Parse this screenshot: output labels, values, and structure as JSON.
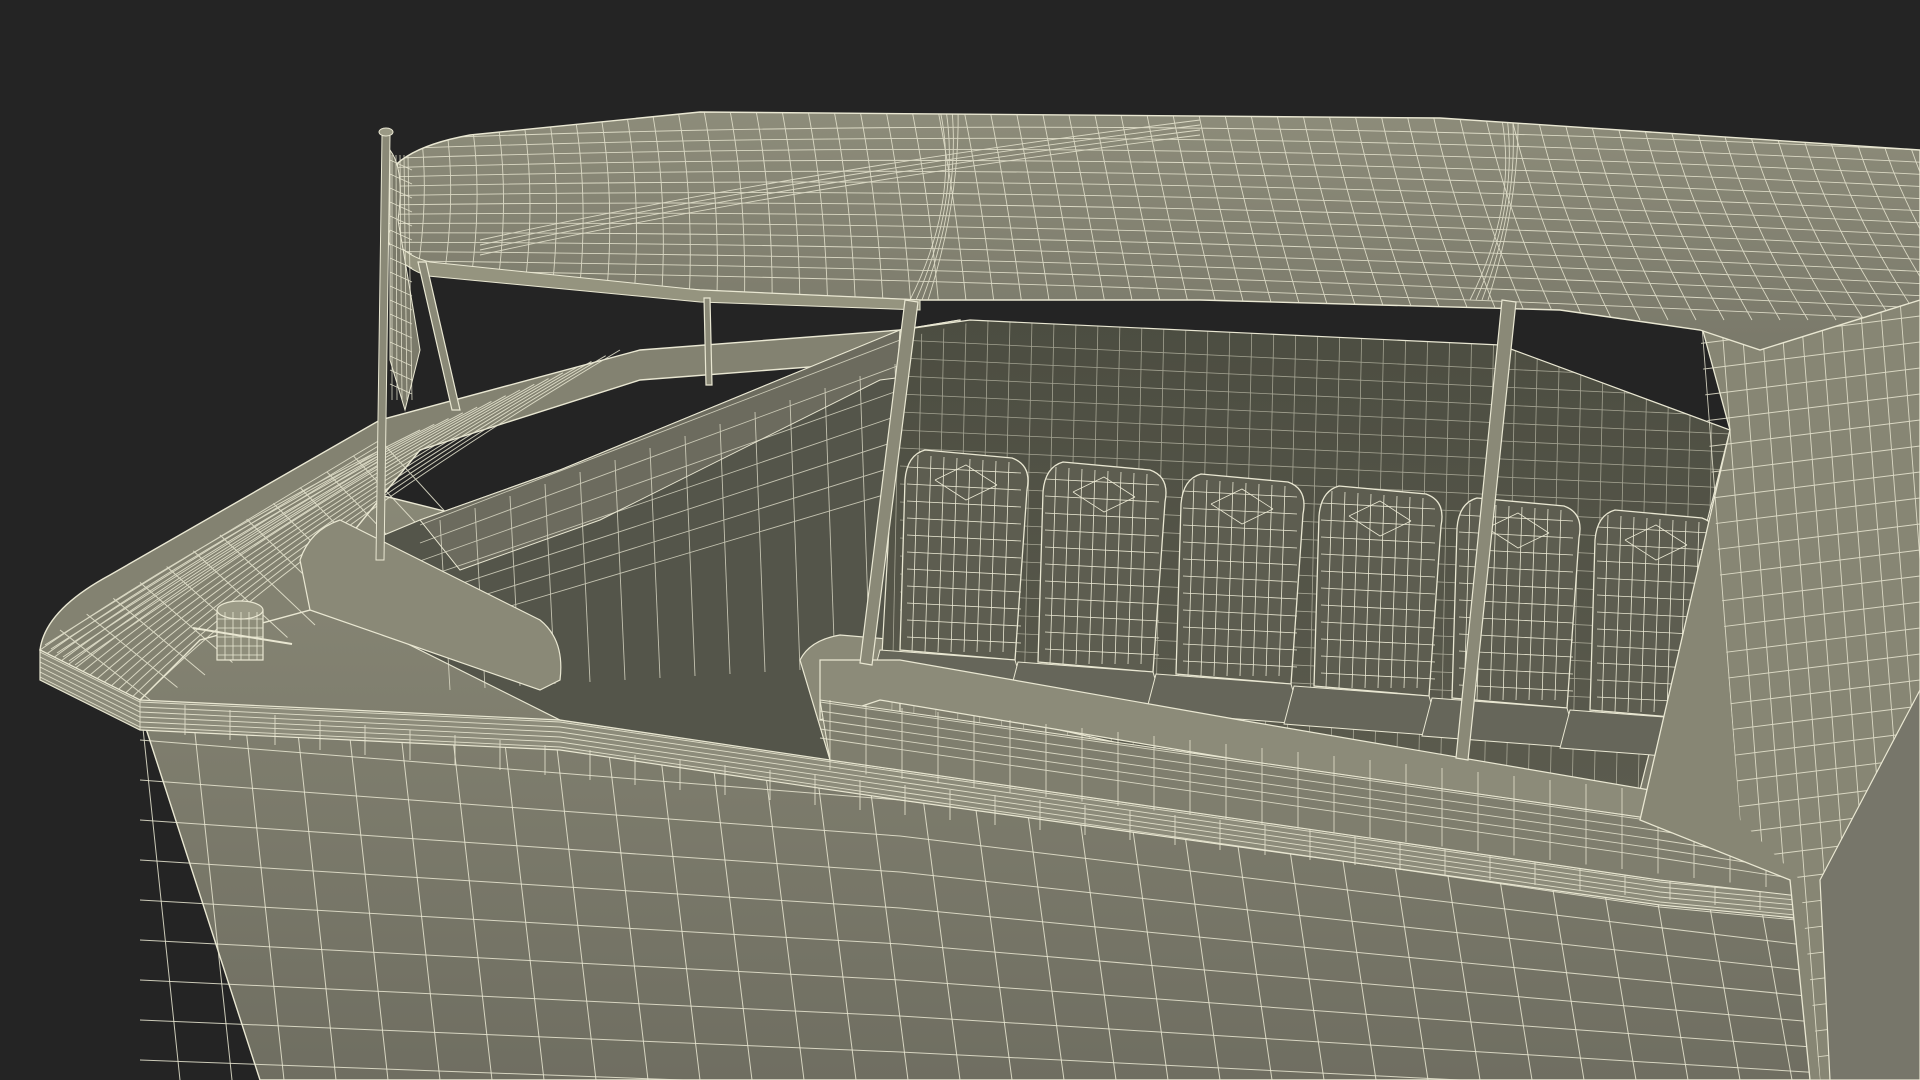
{
  "scene": {
    "subject": "water-taxi-wireframe-model",
    "render_style": "wireframe-over-shaded",
    "colors": {
      "background": "#242424",
      "surface": "#7c7b6c",
      "surface_light": "#8a8977",
      "surface_dark": "#5f5e52",
      "interior": "#545547",
      "seat": "#5d5d50",
      "wire": "#e9e7d2"
    },
    "seat_count": 6
  }
}
